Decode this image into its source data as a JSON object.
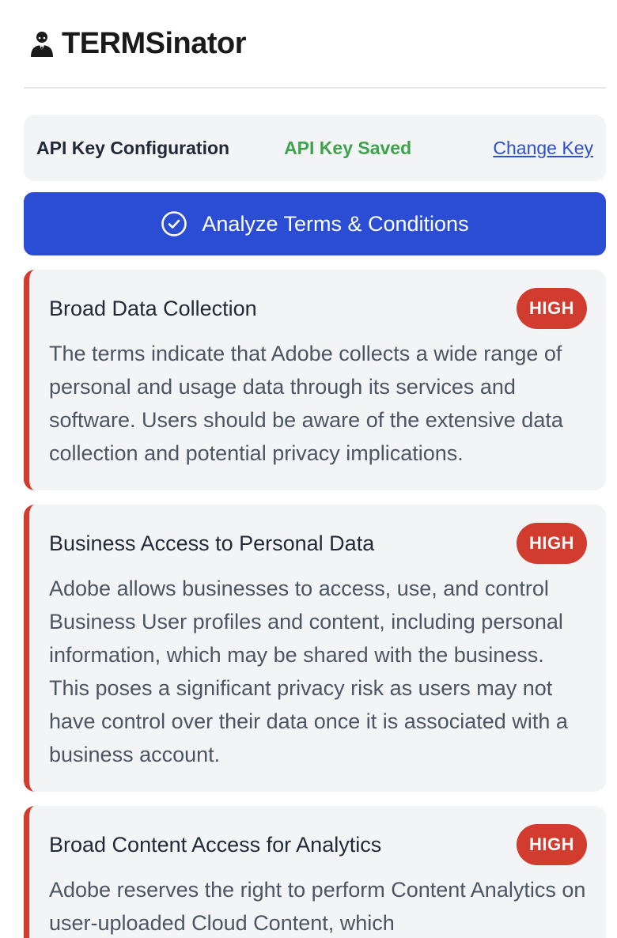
{
  "app": {
    "title": "TERMSinator",
    "logo_icon": "person-in-suit-icon"
  },
  "api": {
    "label": "API Key Configuration",
    "status": "API Key Saved",
    "change_label": "Change Key"
  },
  "actions": {
    "analyze_label": "Analyze Terms & Conditions",
    "analyze_icon": "check-circle-icon"
  },
  "colors": {
    "accent": "#2a4dd4",
    "success": "#3fa34d",
    "high": "#d23c2f",
    "card_bg": "#f3f4f6"
  },
  "issues": [
    {
      "title": "Broad Data Collection",
      "severity": "HIGH",
      "description": "The terms indicate that Adobe collects a wide range of personal and usage data through its services and software. Users should be aware of the extensive data collection and potential privacy implications."
    },
    {
      "title": "Business Access to Personal Data",
      "severity": "HIGH",
      "description": "Adobe allows businesses to access, use, and control Business User profiles and content, including personal information, which may be shared with the business. This poses a significant privacy risk as users may not have control over their data once it is associated with a business account."
    },
    {
      "title": "Broad Content Access for Analytics",
      "severity": "HIGH",
      "description": "Adobe reserves the right to perform Content Analytics on user-uploaded Cloud Content, which"
    }
  ]
}
